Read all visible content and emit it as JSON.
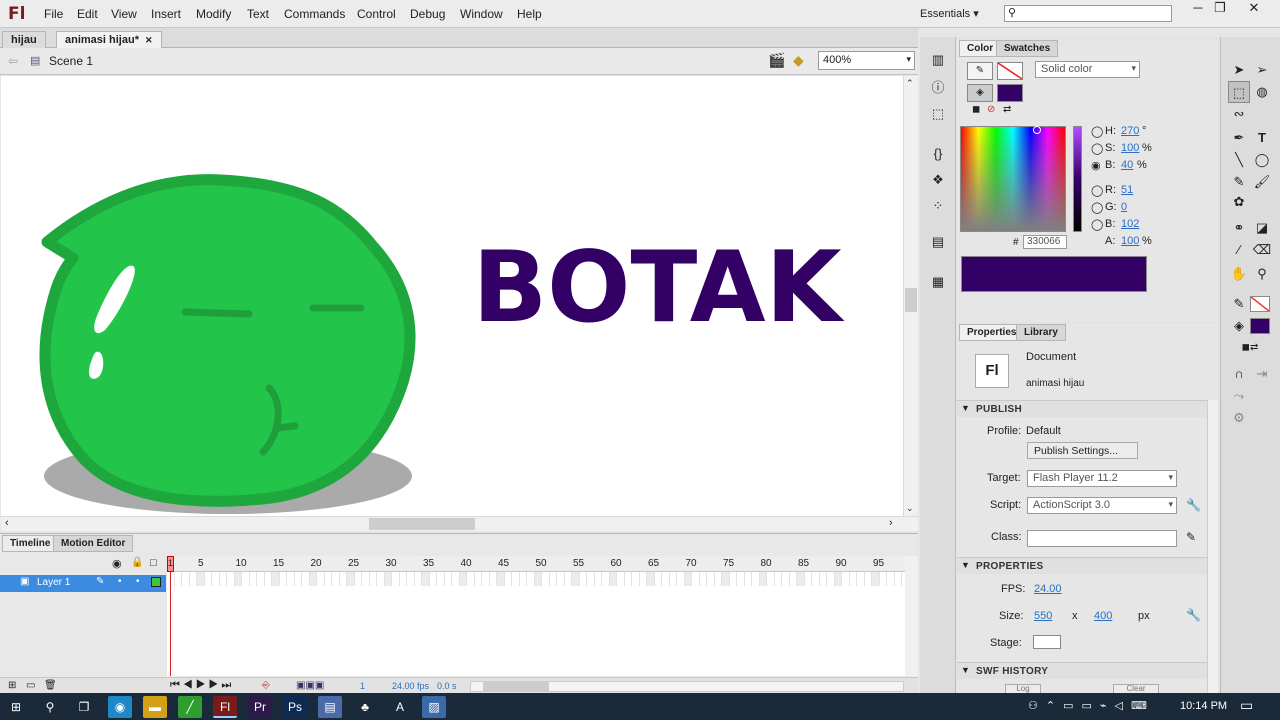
{
  "app": {
    "logo": "Fl",
    "menus": [
      "File",
      "Edit",
      "View",
      "Insert",
      "Modify",
      "Text",
      "Commands",
      "Control",
      "Debug",
      "Window",
      "Help"
    ],
    "workspace": "Essentials"
  },
  "doc_tabs": [
    "hijau",
    "animasi hijau*"
  ],
  "edit_bar": {
    "scene": "Scene 1",
    "zoom": "400%"
  },
  "stage": {
    "title_text": "BOTAK",
    "accent": "#330066",
    "blob_color": "#22c44a",
    "blob_outline": "#1ea73c",
    "shadow_color": "#aaaaaa"
  },
  "timeline": {
    "tabs": [
      "Timeline",
      "Motion Editor"
    ],
    "layer_name": "Layer 1",
    "ruler": [
      "5",
      "10",
      "15",
      "20",
      "25",
      "30",
      "35",
      "40",
      "45",
      "50",
      "55",
      "60",
      "65",
      "70",
      "75",
      "80",
      "85",
      "90",
      "95"
    ],
    "first_frame": "1",
    "status": {
      "frame": "1",
      "fps": "24.00 fps",
      "time": "0.0 s"
    }
  },
  "color_panel": {
    "tabs": [
      "Color",
      "Swatches"
    ],
    "type": "Solid color",
    "H": "270",
    "S": "100",
    "B": "40",
    "R": "51",
    "G": "0",
    "Bv": "102",
    "A": "100",
    "hex": "330066",
    "degree": "°",
    "percent": "%",
    "labels": {
      "h": "H:",
      "s": "S:",
      "b": "B:",
      "r": "R:",
      "g": "G:",
      "bb": "B:",
      "a": "A:",
      "hash": "#"
    }
  },
  "properties": {
    "tabs": [
      "Properties",
      "Library"
    ],
    "doc_label": "Document",
    "doc_name": "animasi hijau",
    "icon_text": "Fl",
    "publish_header": "PUBLISH",
    "profile_label": "Profile:",
    "profile_value": "Default",
    "publish_button": "Publish Settings...",
    "target_label": "Target:",
    "target_value": "Flash Player 11.2",
    "script_label": "Script:",
    "script_value": "ActionScript 3.0",
    "class_label": "Class:",
    "props_header": "PROPERTIES",
    "fps_label": "FPS:",
    "fps_value": "24.00",
    "size_label": "Size:",
    "width": "550",
    "x": "x",
    "height": "400",
    "px": "px",
    "stage_label": "Stage:",
    "swf_header": "SWF HISTORY",
    "log_button": "Log",
    "clear_button": "Clear"
  },
  "taskbar": {
    "time": "10:14 PM"
  }
}
